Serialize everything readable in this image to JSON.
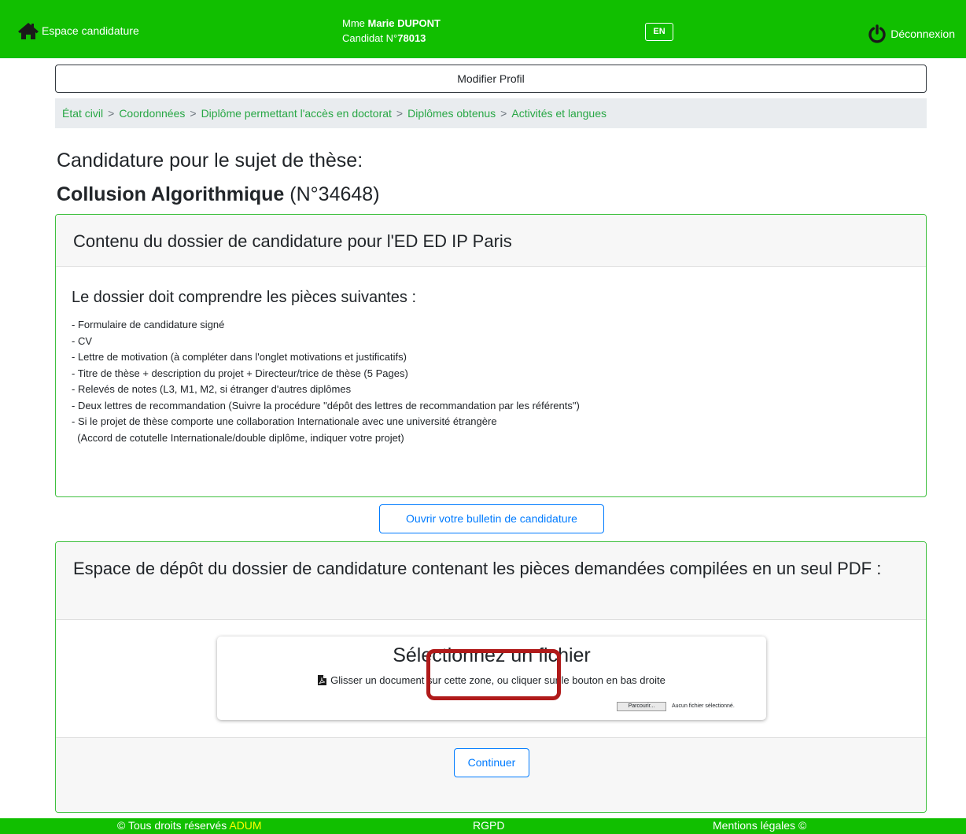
{
  "header": {
    "home_label": "Espace candidature",
    "user_civility": "Mme",
    "user_name": "Marie DUPONT",
    "candidate_prefix": "Candidat N°",
    "candidate_number": "78013",
    "lang_button": "EN",
    "logout_label": "Déconnexion",
    "home_icon": "home-icon",
    "logout_icon": "power-icon",
    "bar_color": "#11bf00"
  },
  "profile_button": "Modifier Profil",
  "breadcrumb": [
    "État civil",
    "Coordonnées",
    "Diplôme permettant l'accès en doctorat",
    "Diplômes obtenus",
    "Activités et langues"
  ],
  "breadcrumb_separator": ">",
  "subject": {
    "heading": "Candidature pour le sujet de thèse:",
    "title": "Collusion Algorithmique",
    "number": "(N°34648)"
  },
  "dossier_card": {
    "title": "Contenu du dossier de candidature pour l'ED ED IP Paris",
    "intro": "Le dossier doit comprendre les pièces suivantes :",
    "items": [
      "- Formulaire de candidature signé",
      "- CV",
      "- Lettre de motivation (à compléter dans l'onglet motivations et justificatifs)",
      "- Titre de thèse + description du projet + Directeur/trice de thèse (5 Pages)",
      "- Relevés de notes (L3, M1, M2, si étranger d'autres diplômes",
      "- Deux lettres de recommandation (Suivre la procédure \"dépôt des lettres de recommandation par les référents\")",
      "- Si le projet de thèse comporte une collaboration Internationale avec une université étrangère",
      "  (Accord de cotutelle Internationale/double diplôme, indiquer votre projet)"
    ]
  },
  "bulletin_button": "Ouvrir votre bulletin de candidature",
  "upload_card": {
    "title": "Espace de dépôt du dossier de candidature contenant les pièces demandées compilées en un seul PDF :",
    "dropzone_title": "Sélectionnez un fichier",
    "dropzone_hint": "Glisser un document sur cette zone, ou cliquer sur le bouton en bas droite",
    "dropzone_icon": "pdf-file-icon",
    "browse_label": "Parcourir...",
    "no_file_label": "Aucun fichier sélectionné.",
    "continue_label": "Continuer",
    "highlight_color": "#b01a1a"
  },
  "footer": {
    "rights_text": "© Tous droits réservés",
    "rights_link": "ADUM",
    "rgpd": "RGPD",
    "legal": "Mentions légales ©"
  }
}
